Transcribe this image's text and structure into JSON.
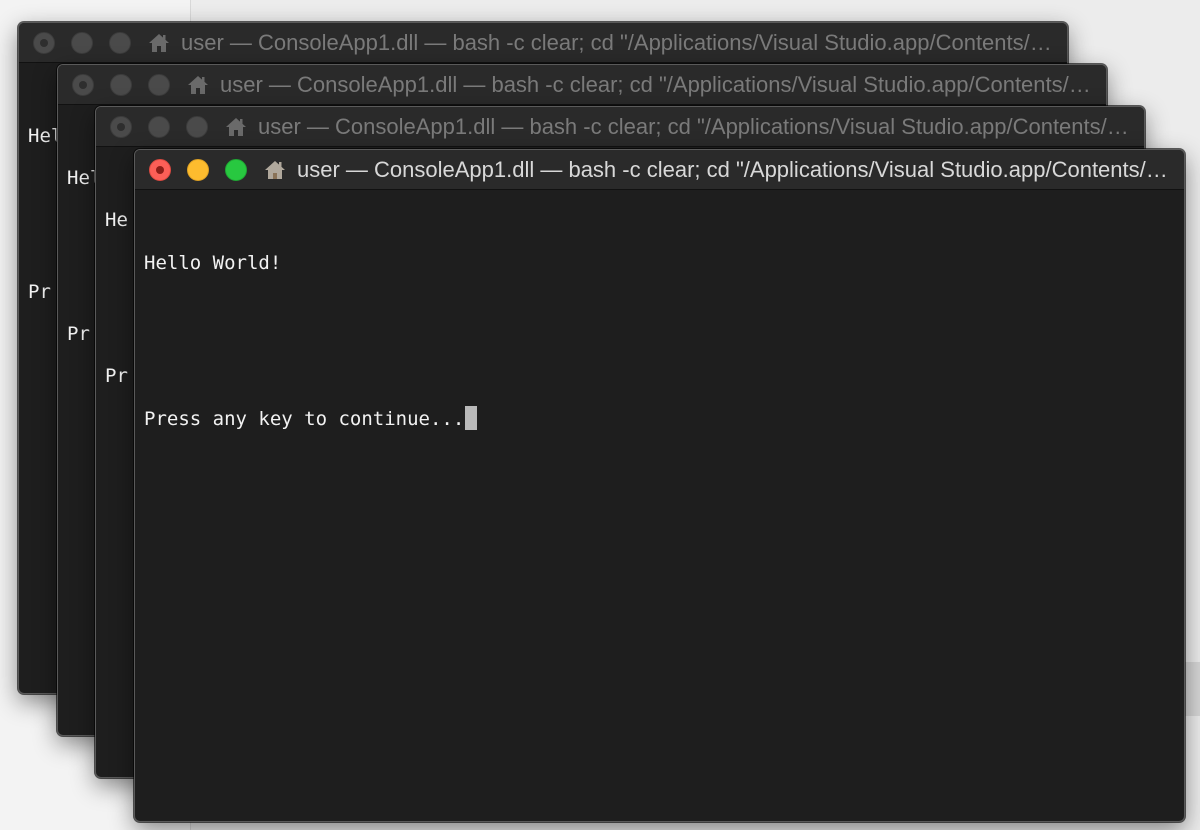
{
  "windows": [
    {
      "title": "user — ConsoleApp1.dll — bash -c clear; cd \"/Applications/Visual Studio.app/Contents/Resources\"",
      "visible_lines": [
        "Hel",
        "",
        "Pr"
      ]
    },
    {
      "title": "user — ConsoleApp1.dll — bash -c clear; cd \"/Applications/Visual Studio.app/Contents/Resources\"",
      "visible_lines": [
        "Hel",
        "",
        "Pr"
      ]
    },
    {
      "title": "user — ConsoleApp1.dll — bash -c clear; cd \"/Applications/Visual Studio.app/Contents/Resources\"",
      "visible_lines": [
        "He",
        "",
        "Pr"
      ]
    },
    {
      "title": "user — ConsoleApp1.dll — bash -c clear; cd \"/Applications/Visual Studio.app/Contents/Resources\"",
      "lines": [
        "Hello World!",
        "",
        "Press any key to continue..."
      ]
    }
  ],
  "icons": {
    "close": "close-icon",
    "minimize": "minimize-icon",
    "zoom": "zoom-icon",
    "home": "home-icon",
    "cursor": "block-cursor"
  },
  "colors": {
    "close": "#fc5f57",
    "minimize": "#fdbc2e",
    "zoom": "#28c840",
    "terminal_bg": "#1e1e1e",
    "terminal_text": "#f2f2f2"
  }
}
